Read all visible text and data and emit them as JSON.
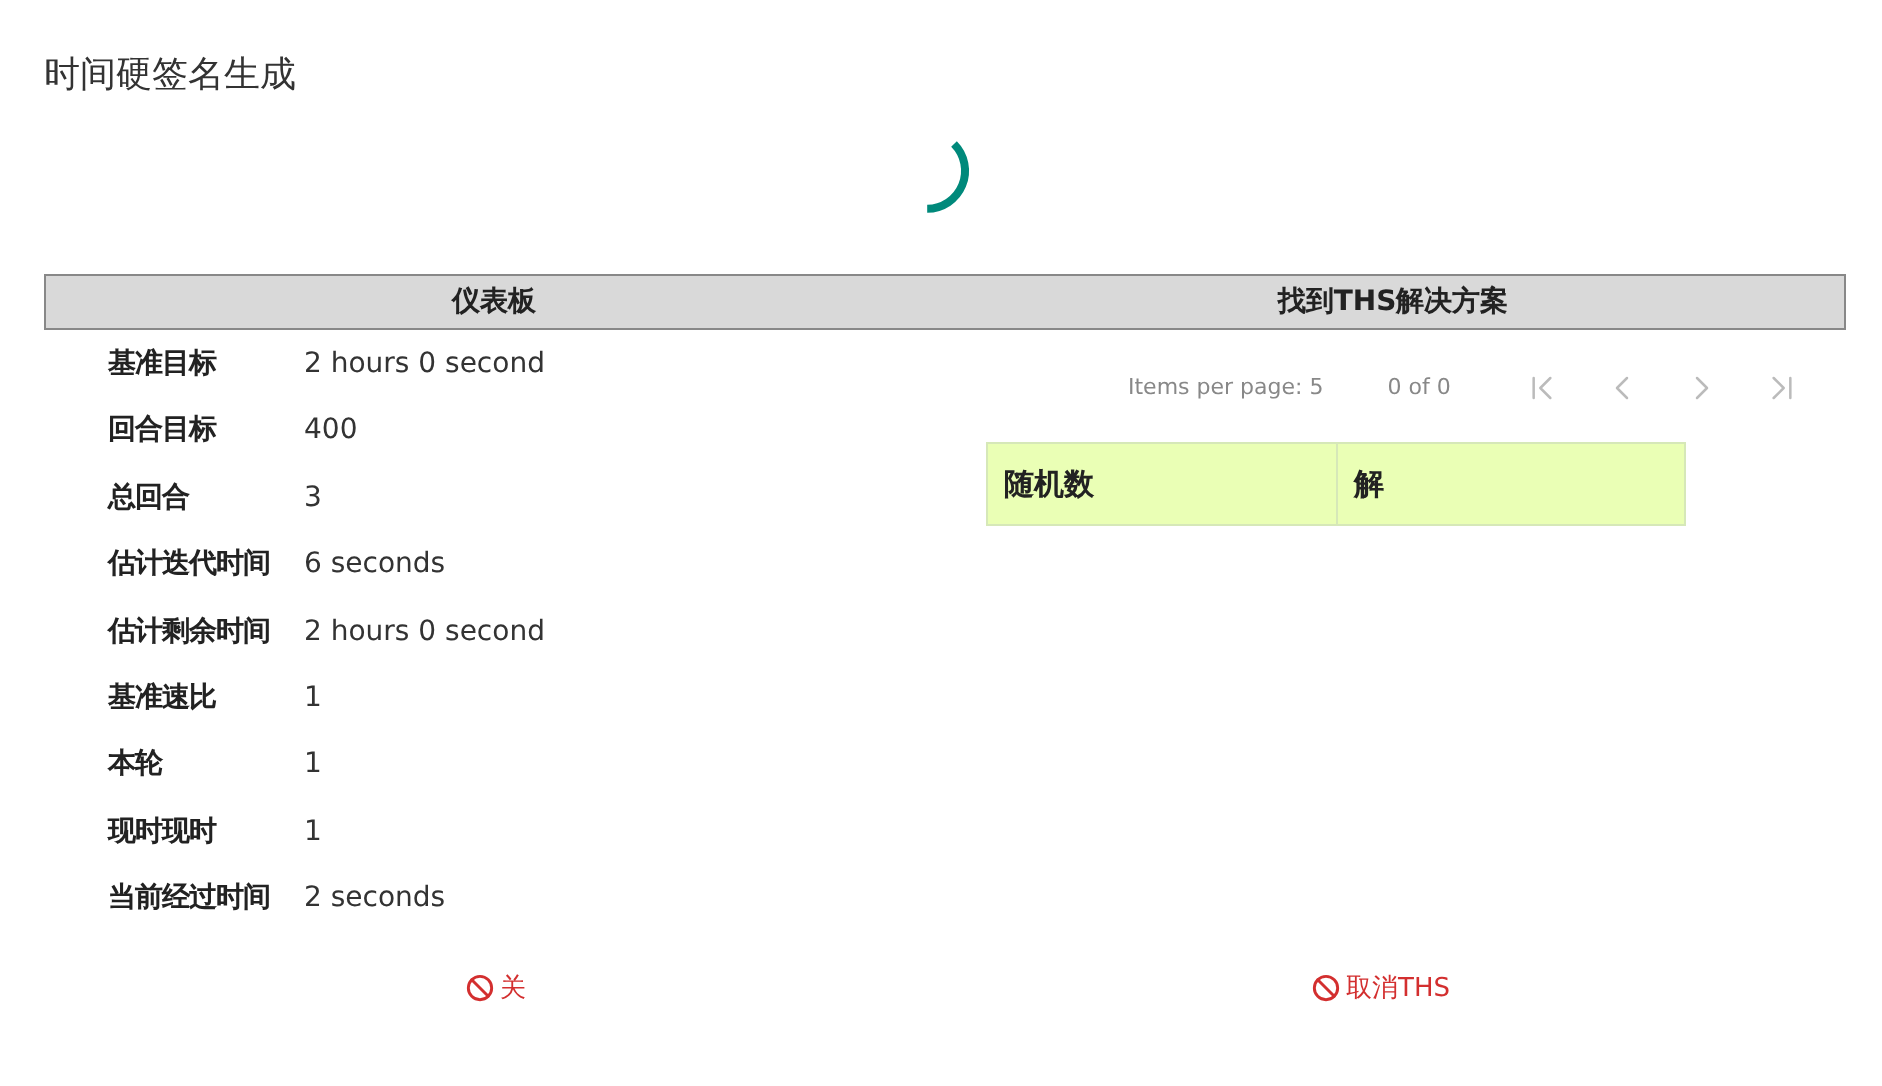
{
  "dialog": {
    "title": "时间硬签名生成"
  },
  "dashboard": {
    "heading": "仪表板",
    "rows": [
      {
        "label": "基准目标",
        "value": "2 hours 0 second"
      },
      {
        "label": "回合目标",
        "value": "400"
      },
      {
        "label": "总回合",
        "value": "3"
      },
      {
        "label": "估计迭代时间",
        "value": "6 seconds"
      },
      {
        "label": "估计剩余时间",
        "value": "2 hours 0 second"
      },
      {
        "label": "基准速比",
        "value": "1"
      },
      {
        "label": "本轮",
        "value": "1"
      },
      {
        "label": "现时现时",
        "value": "1"
      },
      {
        "label": "当前经过时间",
        "value": "2 seconds"
      }
    ]
  },
  "solutions": {
    "heading": "找到THS解决方案",
    "paginator": {
      "items_per_page": "Items per page: 5",
      "range": "0 of 0",
      "buttons": [
        {
          "kind": "first",
          "disabled": true
        },
        {
          "kind": "prev",
          "disabled": true
        },
        {
          "kind": "next",
          "disabled": true
        },
        {
          "kind": "last",
          "disabled": true
        }
      ]
    },
    "table": {
      "columns": [
        "随机数",
        "解"
      ]
    }
  },
  "actions": [
    {
      "label": "关"
    },
    {
      "label": "取消THS"
    }
  ]
}
